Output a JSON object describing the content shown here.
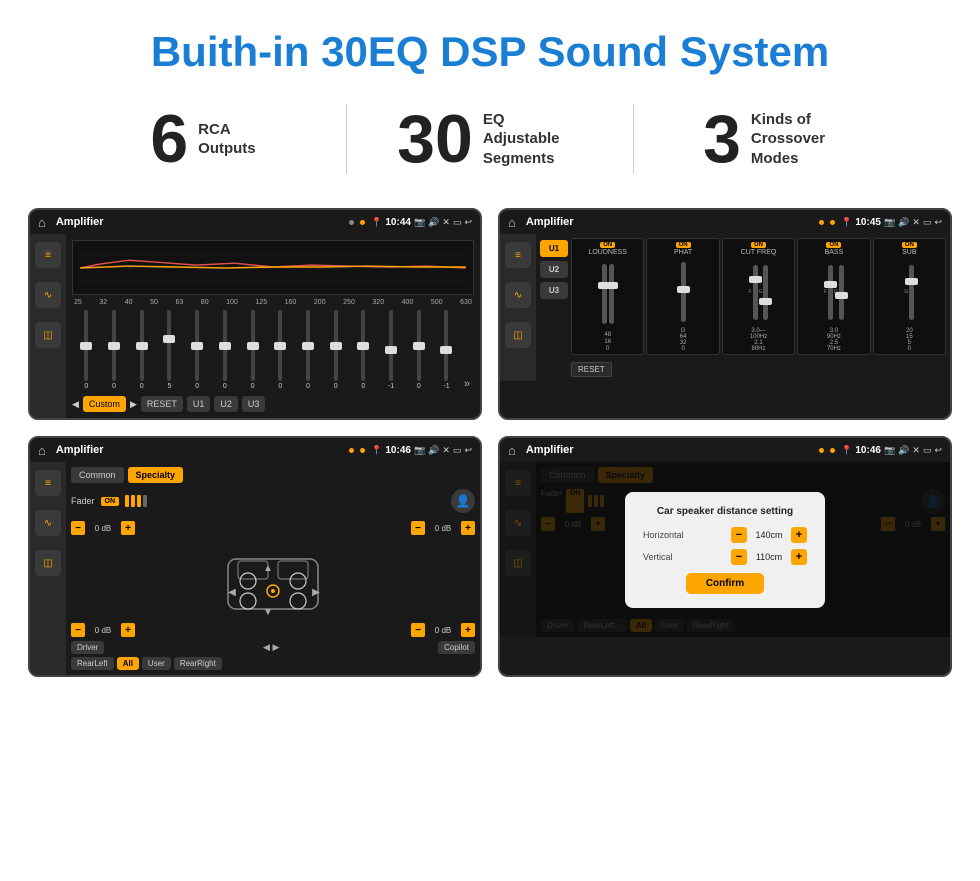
{
  "header": {
    "title": "Buith-in 30EQ DSP Sound System"
  },
  "stats": [
    {
      "number": "6",
      "label1": "RCA",
      "label2": "Outputs"
    },
    {
      "number": "30",
      "label1": "EQ Adjustable",
      "label2": "Segments"
    },
    {
      "number": "3",
      "label1": "Kinds of",
      "label2": "Crossover Modes"
    }
  ],
  "screens": {
    "s1": {
      "status_bar": {
        "app": "Amplifier",
        "time": "10:44"
      },
      "eq_frequencies": [
        "25",
        "32",
        "40",
        "50",
        "63",
        "80",
        "100",
        "125",
        "160",
        "200",
        "250",
        "320",
        "400",
        "500",
        "630"
      ],
      "eq_values": [
        "0",
        "0",
        "0",
        "5",
        "0",
        "0",
        "0",
        "0",
        "0",
        "0",
        "0",
        "-1",
        "0",
        "-1"
      ],
      "bottom_buttons": [
        "Custom",
        "RESET",
        "U1",
        "U2",
        "U3"
      ]
    },
    "s2": {
      "status_bar": {
        "app": "Amplifier",
        "time": "10:45"
      },
      "presets": [
        "U1",
        "U2",
        "U3"
      ],
      "channels": [
        {
          "name": "LOUDNESS",
          "badge": "ON"
        },
        {
          "name": "PHAT",
          "badge": "ON"
        },
        {
          "name": "CUT FREQ",
          "badge": "ON"
        },
        {
          "name": "BASS",
          "badge": "ON"
        },
        {
          "name": "SUB",
          "badge": "ON"
        }
      ],
      "reset": "RESET"
    },
    "s3": {
      "status_bar": {
        "app": "Amplifier",
        "time": "10:46"
      },
      "tabs": [
        "Common",
        "Specialty"
      ],
      "active_tab": "Specialty",
      "fader_label": "Fader",
      "fader_on": "ON",
      "db_values": [
        "0 dB",
        "0 dB",
        "0 dB",
        "0 dB"
      ],
      "position_btns": [
        "Driver",
        "RearLeft",
        "All",
        "User",
        "Copilot",
        "RearRight"
      ]
    },
    "s4": {
      "status_bar": {
        "app": "Amplifier",
        "time": "10:46"
      },
      "tabs": [
        "Common",
        "Specialty"
      ],
      "dialog": {
        "title": "Car speaker distance setting",
        "horizontal_label": "Horizontal",
        "horizontal_value": "140cm",
        "vertical_label": "Vertical",
        "vertical_value": "110cm",
        "confirm_label": "Confirm"
      },
      "db_values": [
        "0 dB",
        "0 dB"
      ],
      "position_btns": [
        "Driver",
        "RearLeft...",
        "All",
        "User",
        "RearRight"
      ]
    }
  }
}
